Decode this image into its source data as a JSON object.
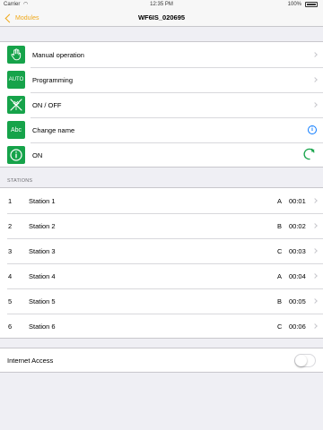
{
  "status_bar": {
    "carrier": "Carrier",
    "time": "12:35 PM",
    "battery": "100%"
  },
  "nav": {
    "back_label": "Modules",
    "title": "WF6IS_020695"
  },
  "menu": {
    "items": [
      {
        "label": "Manual operation",
        "icon": "hand-icon"
      },
      {
        "label": "Programming",
        "icon": "auto-icon",
        "icon_text": "AUTO"
      },
      {
        "label": "ON / OFF",
        "icon": "sprinkler-off-icon"
      },
      {
        "label": "Change name",
        "icon": "abc-icon",
        "icon_text": "Abc"
      },
      {
        "label": "ON",
        "icon": "info-icon"
      }
    ]
  },
  "stations": {
    "header": "STATIONS",
    "rows": [
      {
        "number": "1",
        "name": "Station 1",
        "program": "A",
        "duration": "00:01"
      },
      {
        "number": "2",
        "name": "Station 2",
        "program": "B",
        "duration": "00:02"
      },
      {
        "number": "3",
        "name": "Station 3",
        "program": "C",
        "duration": "00:03"
      },
      {
        "number": "4",
        "name": "Station 4",
        "program": "A",
        "duration": "00:04"
      },
      {
        "number": "5",
        "name": "Station 5",
        "program": "B",
        "duration": "00:05"
      },
      {
        "number": "6",
        "name": "Station 6",
        "program": "C",
        "duration": "00:06"
      }
    ]
  },
  "internet": {
    "label": "Internet Access",
    "enabled": false
  },
  "colors": {
    "accent": "#f0a91a",
    "icon_green": "#16a34a",
    "link_blue": "#0a7aff"
  }
}
